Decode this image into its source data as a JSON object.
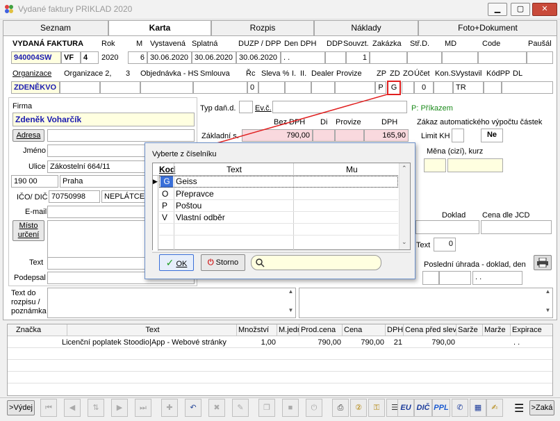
{
  "window": {
    "title": "Vydané faktury PRIKLAD  2020",
    "minimize": "▁",
    "maximize": "▢",
    "close": "✕"
  },
  "tabs": [
    {
      "label": "Seznam"
    },
    {
      "label": "Karta"
    },
    {
      "label": "Rozpis"
    },
    {
      "label": "Náklady"
    },
    {
      "label": "Foto+Dokument"
    }
  ],
  "header1": {
    "labels": {
      "doc": "VYDANÁ FAKTURA",
      "rok": "Rok",
      "m": "M",
      "vystavena": "Vystavená",
      "splatna": "Splatná",
      "duzp": "DUZP / DPP",
      "den_dph": "Den DPH",
      "ddp": "DDP",
      "souvzt": "Souvzt.",
      "zakazka": "Zakázka",
      "strd": "Stř.D.",
      "md": "MD",
      "code": "Code",
      "pausal": "Paušál"
    },
    "values": {
      "number": "940004SW",
      "type": "VF",
      "type_num": "4",
      "rok": "2020",
      "m": "6",
      "vystavena": "30.06.2020",
      "splatna": "30.06.2020",
      "duzp": "30.06.2020",
      "den_dph": ". .",
      "souvzt": "1"
    }
  },
  "header2": {
    "labels": {
      "organizace": "Organizace",
      "organizace2": "Organizace 2,",
      "three": "3",
      "objednavka": "Objednávka - HS",
      "smlouva": "Smlouva",
      "rc": "Řc",
      "sleva": "Sleva %",
      "i": "I.",
      "ii": "II.",
      "dealer": "Dealer",
      "provize": "Provize",
      "zp": "ZP",
      "zd": "ZD",
      "zo": "ZO",
      "ucet": "Účet",
      "kons": "Kon.S.",
      "vystavil": "Vystavil",
      "kodpp": "KódPP",
      "dl": "DL"
    },
    "values": {
      "organizace": "ZDENĚKVO",
      "rc": "0",
      "zp": "P",
      "zd": "G",
      "ucet": "0",
      "vystavil": "TR"
    }
  },
  "firm": {
    "labels": {
      "firma": "Firma",
      "adresa": "Adresa",
      "jmeno": "Jméno",
      "ulice": "Ulice",
      "ico": "IČO/ DIČ",
      "email": "E-mail",
      "misto": "Místo\nurčení",
      "text": "Text",
      "podepsal": "Podepsal"
    },
    "values": {
      "name": "Zdeněk Voharčík",
      "ulice": "Zákostelní 664/11",
      "psc": "190 00",
      "mesto": "Praha",
      "ico": "70750998",
      "dic": "NEPLÁTCE DPH"
    }
  },
  "tax": {
    "labels": {
      "typ_dan": "Typ daň.d.",
      "ev_c": "Ev.č.",
      "prikazem": "P: Příkazem",
      "bez_dph": "Bez DPH",
      "di": "Di",
      "provize": "Provize",
      "dph": "DPH",
      "zaklad": "Základní s.",
      "zakaz": "Zákaz automatického výpočtu částek",
      "limit_kh": "Limit KH",
      "mena": "Měna (cizí), kurz",
      "doklad": "Doklad",
      "cena_jcd": "Cena dle JCD",
      "text": "Text",
      "posledni": "Poslední úhrada - doklad, den"
    },
    "values": {
      "zaklad_bez": "790,00",
      "zaklad_dph": "165,90",
      "limit_ne": "Ne",
      "text_val": "0",
      "posledni_den": ". ."
    }
  },
  "rozpis": {
    "label": "Text do\nrozpisu /\npoznámka"
  },
  "dialog": {
    "title": "Vyberte z číselníku",
    "columns": [
      "Kod",
      "Text",
      "Mu"
    ],
    "rows": [
      {
        "kod": "G",
        "text": "Geiss",
        "selected": true
      },
      {
        "kod": "O",
        "text": "Přepravce"
      },
      {
        "kod": "P",
        "text": "Poštou"
      },
      {
        "kod": "V",
        "text": "Vlastní odběr"
      }
    ],
    "ok": "OK",
    "storno": "Storno",
    "search_value": ""
  },
  "items": {
    "columns": [
      "Značka",
      "Text",
      "Množství",
      "M.jedn",
      "Prod.cena",
      "Cena",
      "DPH",
      "Cena před slev",
      "Sarže",
      "Marže",
      "Expirace"
    ],
    "rows": [
      {
        "znacka": "",
        "text": "Licenční poplatek Stoodio|App - Webové stránky",
        "mnozstvi": "1,00",
        "mjedn": "",
        "prodcena": "790,00",
        "cena": "790,00",
        "dph": "21",
        "cenapred": "790,00",
        "sarze": "",
        "marze": "",
        "expirace": ". ."
      }
    ]
  },
  "bottom": {
    "vydej": ">Výdej",
    "zaka": ">Zaká",
    "eu": "EU",
    "dic": "DIČ",
    "ppl": "PPL"
  },
  "colors": {
    "accent_red": "#e02020",
    "highlight_yellow": "#ffffe0",
    "pink": "#f9d9de",
    "blue_text": "#1a1ab0",
    "selected_row": "#3a6fd8"
  }
}
